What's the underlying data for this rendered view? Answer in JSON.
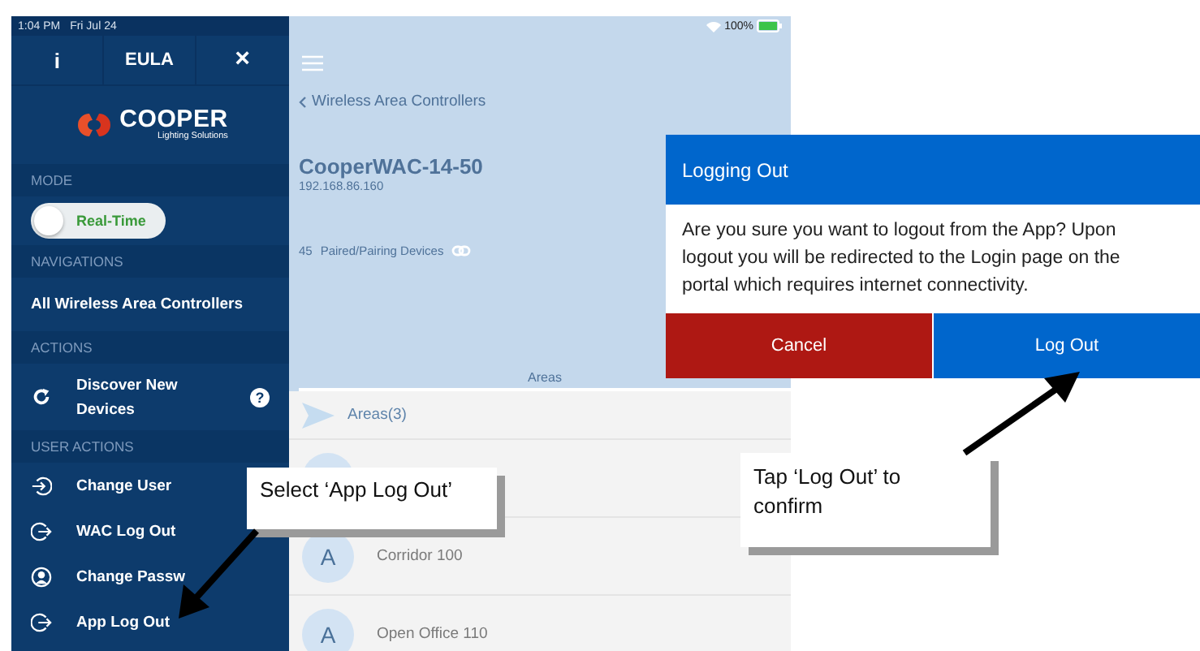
{
  "status_bar": {
    "time": "1:04 PM",
    "date": "Fri Jul 24",
    "battery": "100%"
  },
  "sidebar": {
    "header_buttons": [
      "i",
      "EULA",
      "×"
    ],
    "logo": {
      "name": "COOPER",
      "tagline": "Lighting Solutions"
    },
    "sections": [
      {
        "title": "MODE",
        "items": [
          {
            "kind": "toggle",
            "label": "Real-Time",
            "on": false
          }
        ]
      },
      {
        "title": "NAVIGATIONS",
        "items": [
          {
            "kind": "link",
            "label": "All Wireless Area Controllers"
          }
        ]
      },
      {
        "title": "ACTIONS",
        "items": [
          {
            "kind": "action",
            "label": "Discover New Devices",
            "help": "?"
          }
        ]
      },
      {
        "title": "USER ACTIONS",
        "items": [
          {
            "kind": "action",
            "label": "Change User"
          },
          {
            "kind": "action",
            "label": "WAC Log Out"
          },
          {
            "kind": "action",
            "label": "Change Passw"
          },
          {
            "kind": "action",
            "label": "App Log Out"
          }
        ]
      }
    ]
  },
  "main": {
    "back_link": "Wireless Area Controllers",
    "device": {
      "name": "CooperWAC-14-50",
      "ip": "192.168.86.160",
      "count": "45",
      "count_label": "Paired/Pairing Devices"
    },
    "tabs": [
      {
        "label": "Areas",
        "selected": true
      }
    ],
    "list": [
      {
        "kind": "group",
        "label": "Areas(3)"
      },
      {
        "kind": "area"
      },
      {
        "kind": "area",
        "avatar": "A",
        "label": "Corridor 100"
      },
      {
        "kind": "area",
        "avatar": "A",
        "label": "Open Office 110"
      }
    ]
  },
  "dialog": {
    "title": "Logging Out",
    "message": "Are you sure you want to logout from the App? Upon logout you will be redirected to the Login page on the portal which requires internet connectivity.",
    "buttons": [
      {
        "kind": "cancel",
        "label": "Cancel"
      },
      {
        "kind": "confirm",
        "label": "Log Out"
      }
    ]
  },
  "callouts": [
    {
      "text": "Select ‘App Log Out’"
    },
    {
      "text": "Tap ‘Log Out’ to confirm"
    }
  ]
}
